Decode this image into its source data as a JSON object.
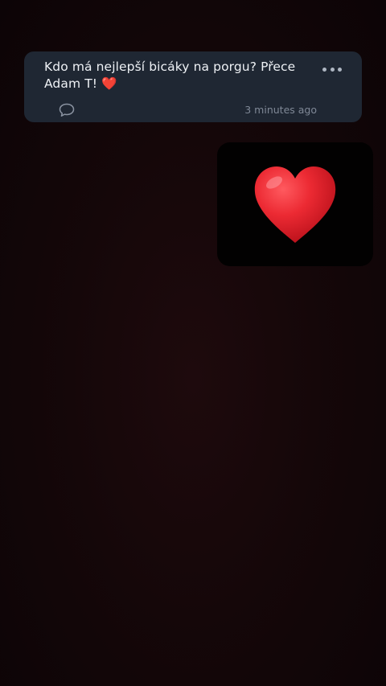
{
  "post": {
    "text_line1": "Kdo má nejlepší bicáky na porgu? Přece",
    "text_line2": "Adam T! ❤️",
    "timestamp": "3 minutes ago"
  },
  "icons": {
    "more": "more-horizontal-icon",
    "comment": "comment-bubble-icon",
    "heart": "red-heart-emoji"
  },
  "colors": {
    "background": "#150709",
    "card": "#1f2733",
    "heart": "#e8222c"
  }
}
